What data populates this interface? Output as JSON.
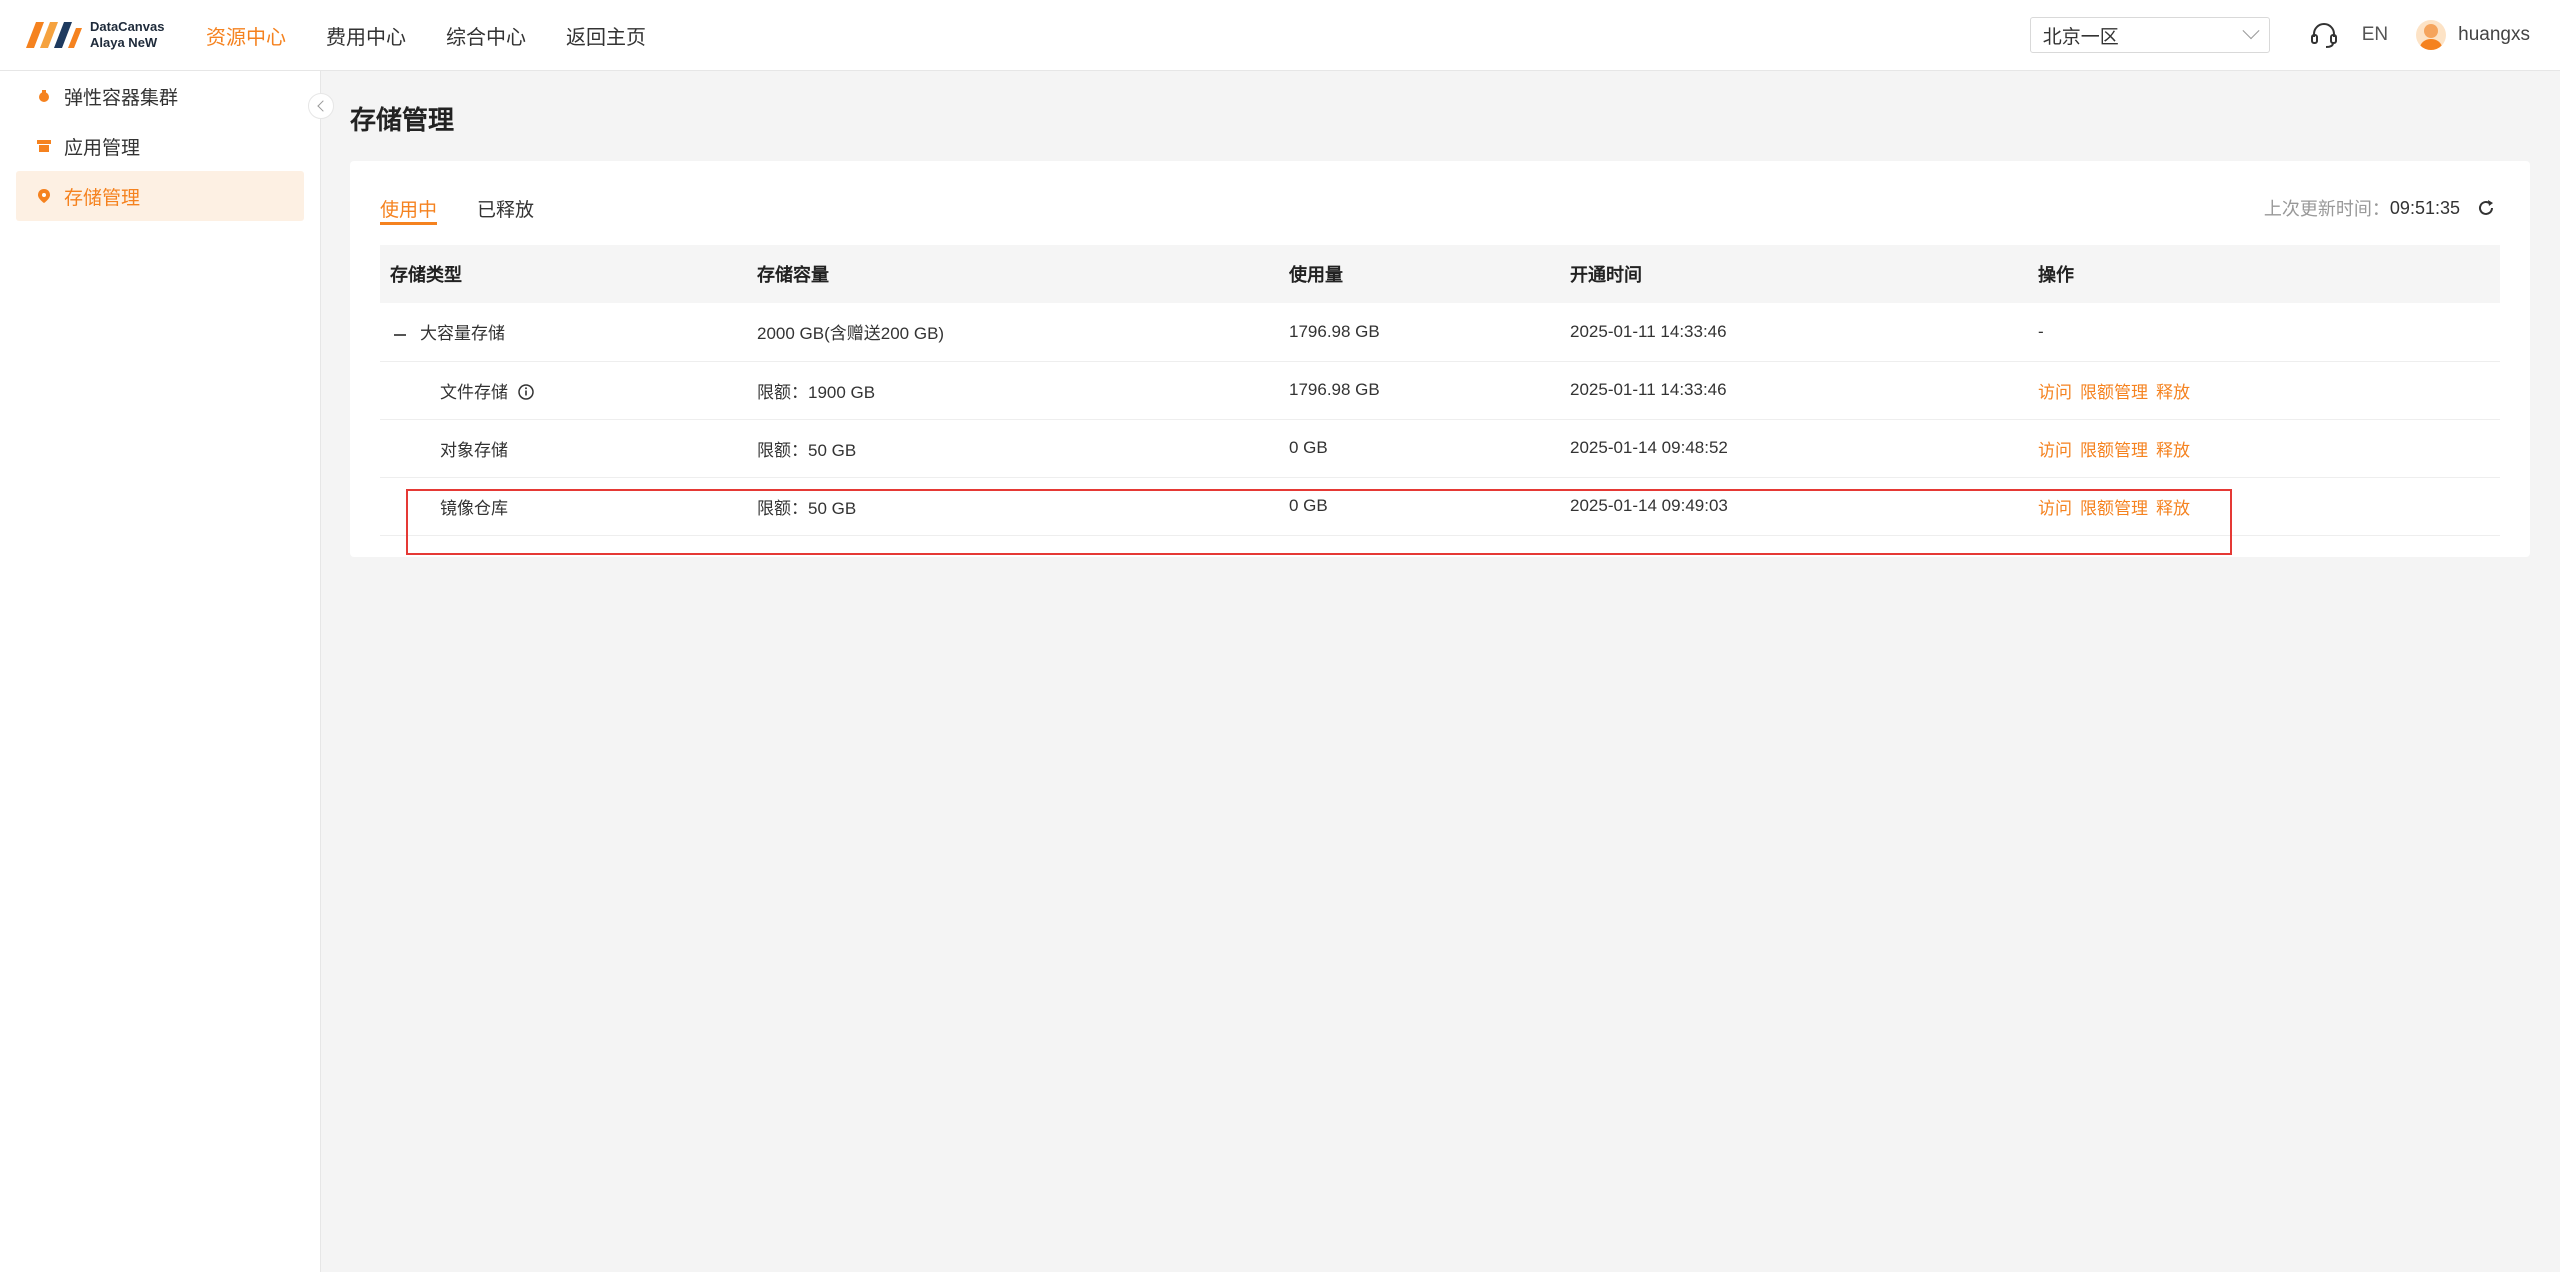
{
  "app": {
    "logo_line1": "DataCanvas",
    "logo_line2": "Alaya NeW",
    "accent_color": "#f5821f"
  },
  "nav": {
    "items": [
      {
        "label": "资源中心",
        "active": true
      },
      {
        "label": "费用中心",
        "active": false
      },
      {
        "label": "综合中心",
        "active": false
      },
      {
        "label": "返回主页",
        "active": false
      }
    ]
  },
  "topbar": {
    "region": "北京一区",
    "lang": "EN",
    "username": "huangxs"
  },
  "sidebar": {
    "items": [
      {
        "label": "弹性容器集群",
        "icon": "cluster-icon",
        "active": false
      },
      {
        "label": "应用管理",
        "icon": "app-icon",
        "active": false
      },
      {
        "label": "存储管理",
        "icon": "storage-icon",
        "active": true
      }
    ]
  },
  "page": {
    "title": "存储管理",
    "tabs": [
      {
        "label": "使用中",
        "active": true
      },
      {
        "label": "已释放",
        "active": false
      }
    ],
    "update_label": "上次更新时间：",
    "update_time": "09:51:35"
  },
  "table": {
    "headers": [
      "存储类型",
      "存储容量",
      "使用量",
      "开通时间",
      "操作"
    ],
    "rows": [
      {
        "type": "大容量存储",
        "capacity": "2000 GB(含赠送200 GB)",
        "usage": "1796.98 GB",
        "time": "2025-01-11 14:33:46",
        "ops": "-"
      },
      {
        "type": "文件存储",
        "capacity": "限额：1900 GB",
        "usage": "1796.98 GB",
        "time": "2025-01-11 14:33:46",
        "op1": "访问",
        "op2": "限额管理",
        "op3": "释放"
      },
      {
        "type": "对象存储",
        "capacity": "限额：50 GB",
        "usage": "0 GB",
        "time": "2025-01-14 09:48:52",
        "op1": "访问",
        "op2": "限额管理",
        "op3": "释放"
      },
      {
        "type": "镜像仓库",
        "capacity": "限额：50 GB",
        "usage": "0 GB",
        "time": "2025-01-14 09:49:03",
        "op1": "访问",
        "op2": "限额管理",
        "op3": "释放"
      }
    ]
  }
}
